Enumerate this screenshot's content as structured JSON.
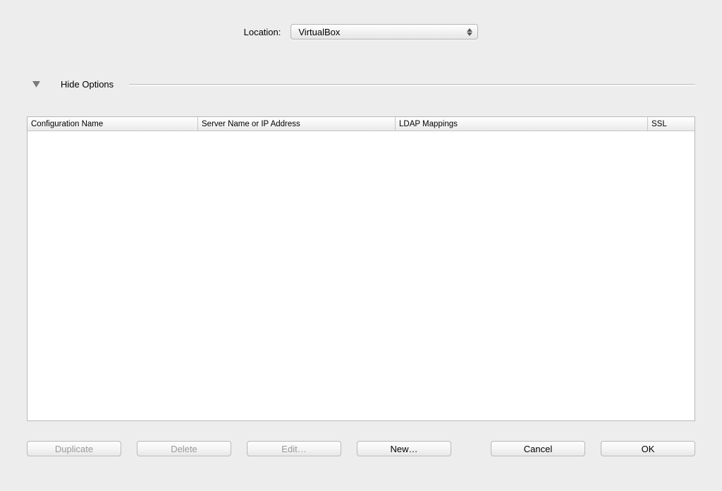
{
  "location": {
    "label": "Location:",
    "selected": "VirtualBox"
  },
  "disclosure": {
    "label": "Hide Options"
  },
  "table": {
    "columns": {
      "config": "Configuration Name",
      "server": "Server Name or IP Address",
      "ldap": "LDAP Mappings",
      "ssl": "SSL"
    },
    "rows": []
  },
  "buttons": {
    "duplicate": "Duplicate",
    "delete": "Delete",
    "edit": "Edit…",
    "new": "New…",
    "cancel": "Cancel",
    "ok": "OK"
  }
}
